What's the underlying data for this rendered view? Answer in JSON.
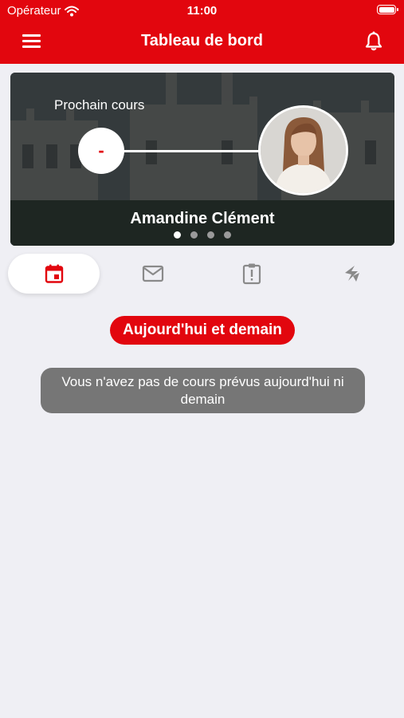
{
  "status_bar": {
    "carrier": "Opérateur",
    "time": "11:00"
  },
  "header": {
    "title": "Tableau de bord"
  },
  "next_course": {
    "label": "Prochain cours",
    "time_value": "-",
    "teacher_name": "Amandine Clément",
    "carousel_active_index": 0,
    "carousel_count": 4
  },
  "tabs": [
    {
      "icon": "calendar-icon",
      "active": true
    },
    {
      "icon": "mail-icon",
      "active": false
    },
    {
      "icon": "clipboard-alert-icon",
      "active": false
    },
    {
      "icon": "lightning-icon",
      "active": false
    }
  ],
  "filter": {
    "label": "Aujourd'hui et demain"
  },
  "empty_message": "Vous n'avez pas de cours prévus aujourd'hui ni demain",
  "colors": {
    "brand": "#e2060e",
    "background": "#efeff4",
    "toast": "#767676"
  }
}
